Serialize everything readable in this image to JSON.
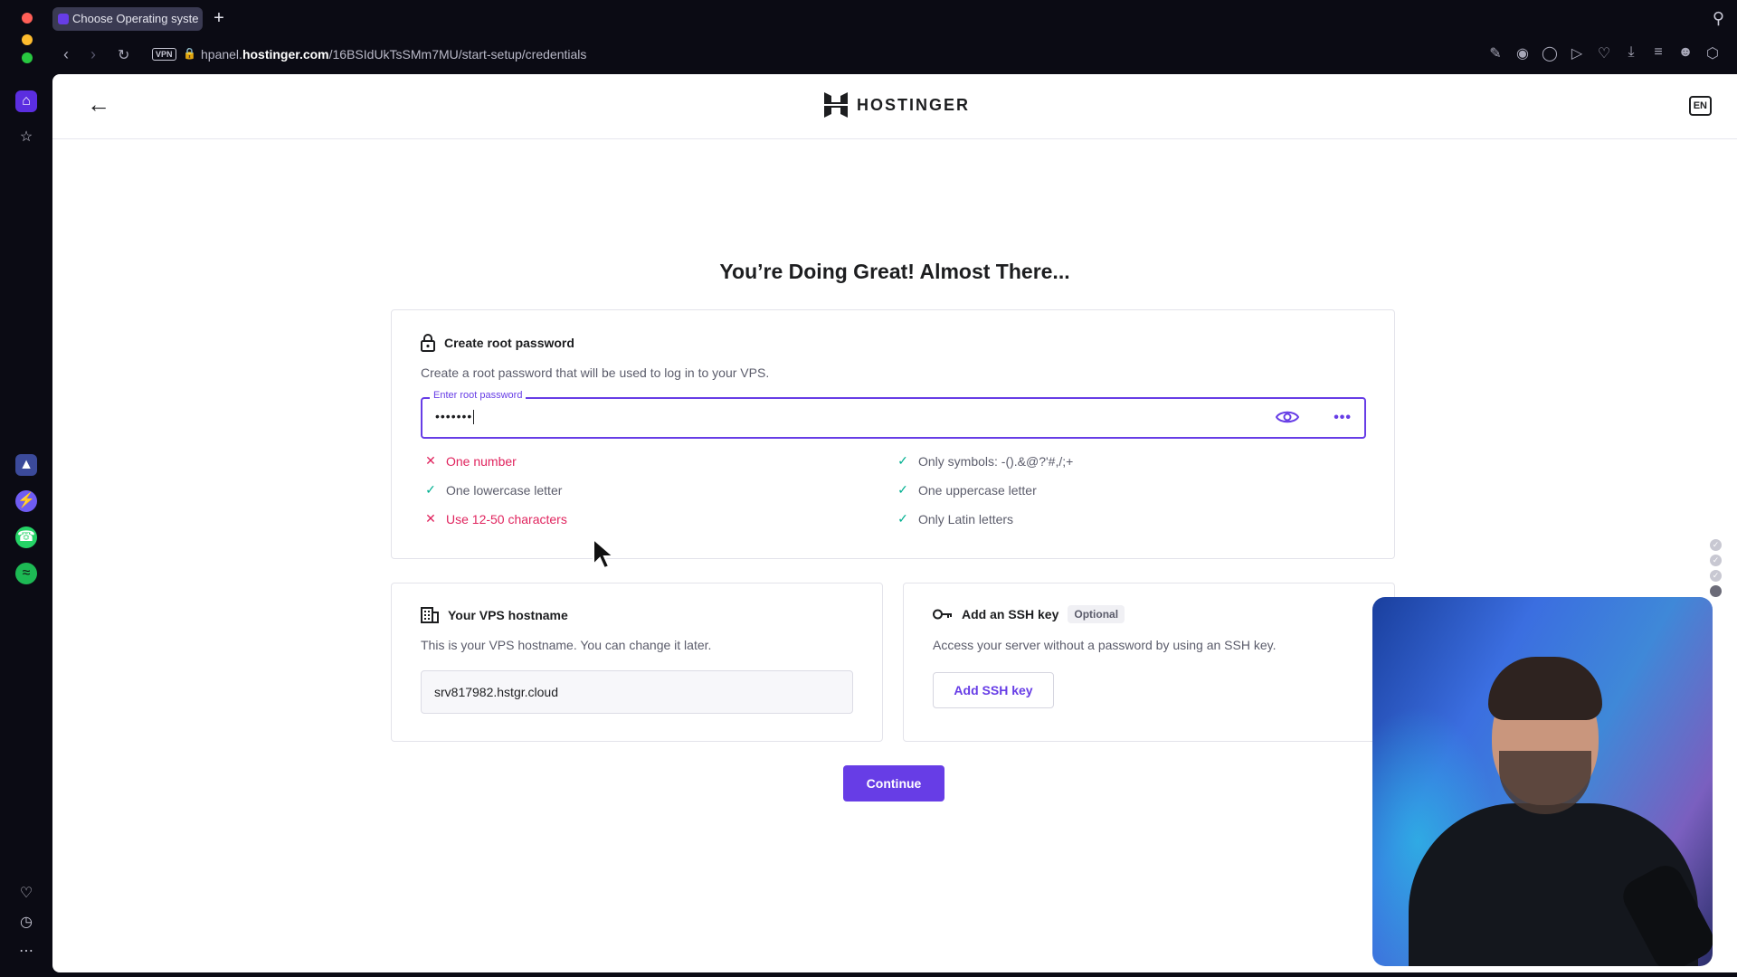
{
  "browser": {
    "tab_title": "Choose Operating syste",
    "new_tab": "+",
    "vpn_badge": "VPN",
    "url_prefix": "hpanel.",
    "url_domain": "hostinger.com",
    "url_path": "/16BSIdUkTsSMm7MU/start-setup/credentials"
  },
  "header": {
    "brand": "HOSTINGER",
    "language": "EN"
  },
  "page": {
    "title": "You’re Doing Great! Almost There..."
  },
  "password_card": {
    "title": "Create root password",
    "description": "Create a root password that will be used to log in to your VPS.",
    "field_label": "Enter root password",
    "field_value": "•••••••",
    "rules_left": [
      {
        "text": "One number",
        "status": "fail"
      },
      {
        "text": "One lowercase letter",
        "status": "ok"
      },
      {
        "text": "Use 12-50 characters",
        "status": "fail"
      }
    ],
    "rules_right": [
      {
        "text": "Only symbols: -().&@?'#,/;+",
        "status": "ok"
      },
      {
        "text": "One uppercase letter",
        "status": "ok"
      },
      {
        "text": "Only Latin letters",
        "status": "ok"
      }
    ]
  },
  "hostname_card": {
    "title": "Your VPS hostname",
    "description": "This is your VPS hostname. You can change it later.",
    "value": "srv817982.hstgr.cloud"
  },
  "ssh_card": {
    "title": "Add an SSH key",
    "badge": "Optional",
    "description": "Access your server without a password by using an SSH key.",
    "button": "Add SSH key"
  },
  "actions": {
    "continue": "Continue"
  },
  "colors": {
    "accent": "#673de6",
    "error": "#e0245e",
    "success": "#00b090"
  }
}
